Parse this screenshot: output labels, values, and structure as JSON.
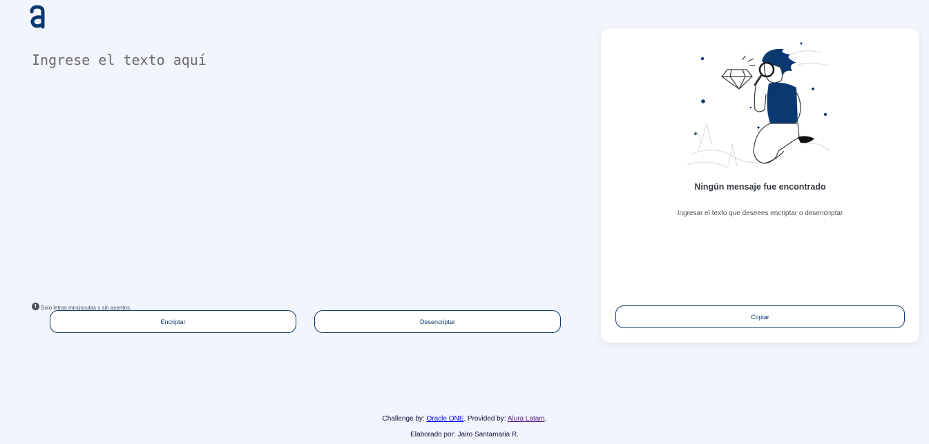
{
  "logo": {
    "icon": "alura-logo-icon",
    "color": "#0a3871"
  },
  "editor": {
    "placeholder": "Ingrese el texto aquí",
    "value": ""
  },
  "hint": {
    "icon": "exclamation-circle-icon",
    "text": "Solo letras minúsculas y sin acentos."
  },
  "buttons": {
    "encrypt": "Encriptar",
    "decrypt": "Desencriptar",
    "copy": "Copiar"
  },
  "result_panel": {
    "illustration": "person-with-magnifying-glass-illustration",
    "title": "Ningún mensaje fue encontrado",
    "subtitle": "Ingresar el texto que deseees encriptar o desencriptar"
  },
  "footer": {
    "challenge_prefix": "Challenge by:",
    "challenge_link": "Oracle ONE",
    "provided_prefix": ". Provided by:",
    "provided_link": "Alura Latam",
    "provided_suffix": ".",
    "author": "Elaborado por: Jairo Santamaria R."
  },
  "colors": {
    "accent": "#0a3871",
    "background": "#f3f5fc",
    "panel": "#ffffff"
  }
}
